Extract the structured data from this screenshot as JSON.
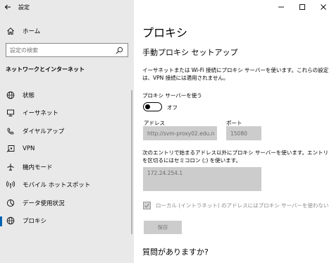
{
  "window": {
    "title": "設定",
    "controls": [
      "minimize",
      "maximize",
      "close"
    ]
  },
  "sidebar": {
    "home_label": "ホーム",
    "search_placeholder": "設定の検索",
    "section_heading": "ネットワークとインターネット",
    "items": [
      {
        "label": "状態",
        "icon": "globe-icon",
        "selected": false
      },
      {
        "label": "イーサネット",
        "icon": "ethernet-icon",
        "selected": false
      },
      {
        "label": "ダイヤルアップ",
        "icon": "dialup-icon",
        "selected": false
      },
      {
        "label": "VPN",
        "icon": "vpn-icon",
        "selected": false
      },
      {
        "label": "機内モード",
        "icon": "airplane-icon",
        "selected": false
      },
      {
        "label": "モバイル ホットスポット",
        "icon": "hotspot-icon",
        "selected": false
      },
      {
        "label": "データ使用状況",
        "icon": "data-usage-icon",
        "selected": false
      },
      {
        "label": "プロキシ",
        "icon": "globe-icon",
        "selected": true
      }
    ]
  },
  "main": {
    "title": "プロキシ",
    "subtitle": "手動プロキシ セットアップ",
    "description": "イーサネットまたは Wi-Fi 接続にプロキシ サーバーを使います。これらの設定は、VPN 接続には適用されません。",
    "proxy_toggle_label": "プロキシ サーバーを使う",
    "proxy_toggle_state": "オフ",
    "address_label": "アドレス",
    "address_value": "http://svm-proxy02.edu.n",
    "port_label": "ポート",
    "port_value": "15080",
    "exceptions_description": "次のエントリで始まるアドレス以外にプロキシ サーバーを使います。エントリを区切るにはセミコロン (;) を使います。",
    "exceptions_value": "172.24.254.1",
    "local_checkbox_label": "ローカル (イントラネット) のアドレスにはプロキシ サーバーを使わない",
    "local_checkbox_checked": true,
    "save_label": "保存",
    "question_heading": "質問がありますか?"
  },
  "colors": {
    "sidebar_bg": "#e9e9e9",
    "accent": "#0063b1",
    "disabled_field": "#cccccc"
  }
}
